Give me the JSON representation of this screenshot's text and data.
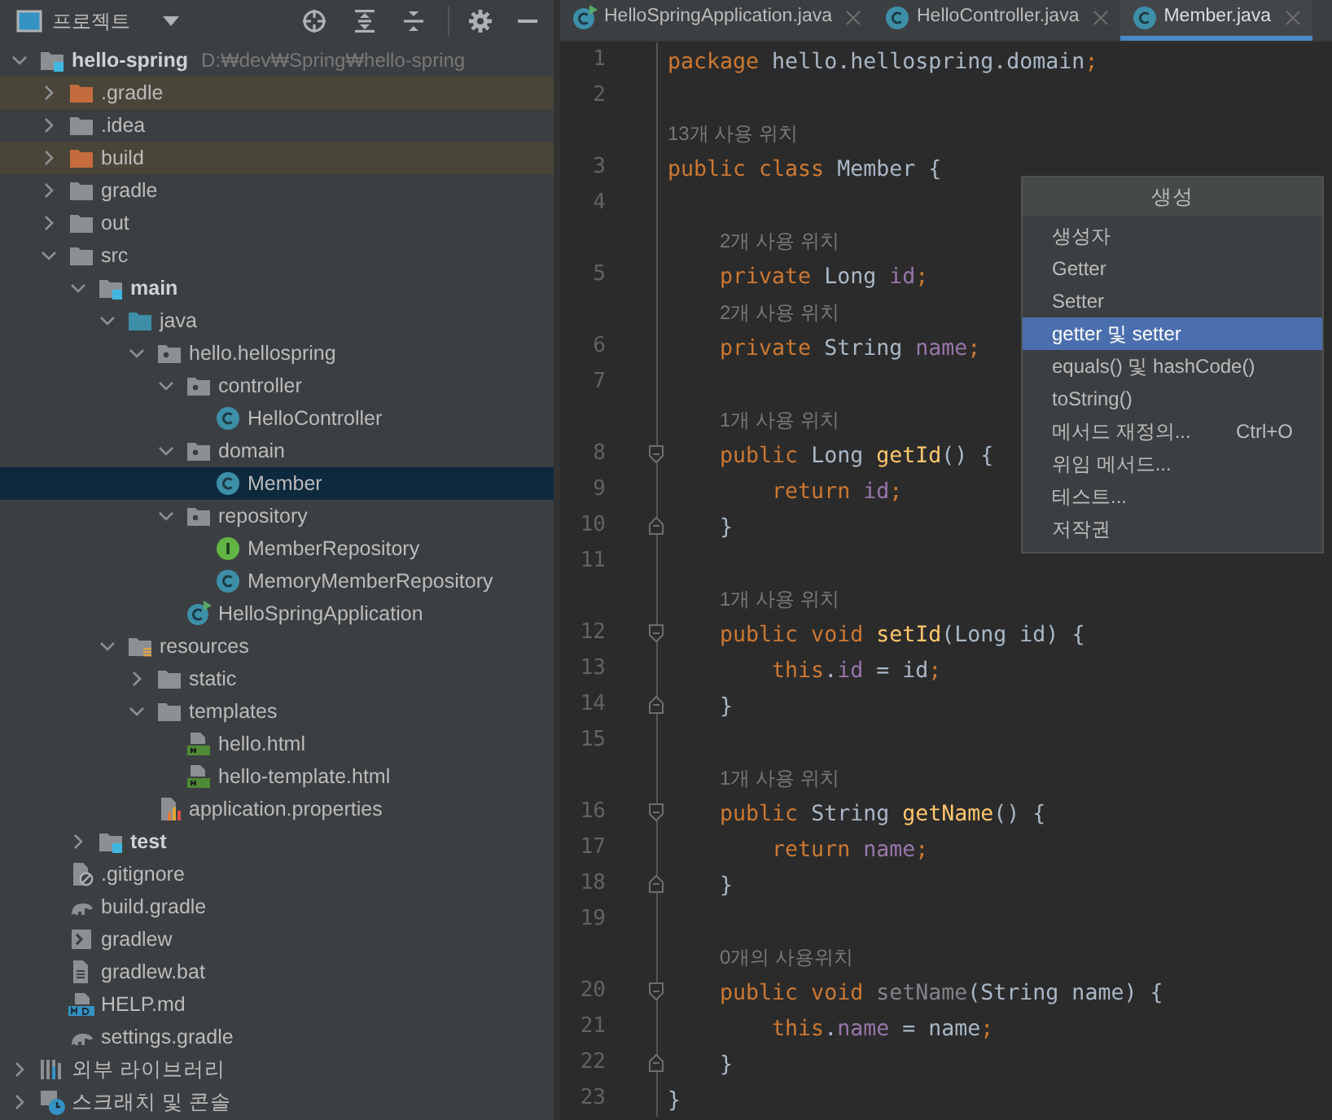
{
  "project_panel": {
    "title": "프로젝트",
    "tree": [
      {
        "label": "hello-spring",
        "path": "D:₩dev₩Spring₩hello-spring",
        "kind": "module",
        "expanded": true,
        "selected": false,
        "children": [
          {
            "label": ".gradle",
            "kind": "excluded",
            "expanded": false,
            "selected": false
          },
          {
            "label": ".idea",
            "kind": "folder",
            "expanded": false,
            "selected": false
          },
          {
            "label": "build",
            "kind": "excluded",
            "expanded": false,
            "selected": false
          },
          {
            "label": "gradle",
            "kind": "folder",
            "expanded": false,
            "selected": false
          },
          {
            "label": "out",
            "kind": "folder",
            "expanded": false,
            "selected": false
          },
          {
            "label": "src",
            "kind": "folder",
            "expanded": true,
            "selected": false,
            "children": [
              {
                "label": "main",
                "kind": "module",
                "expanded": true,
                "selected": false,
                "children": [
                  {
                    "label": "java",
                    "kind": "source",
                    "expanded": true,
                    "selected": false,
                    "children": [
                      {
                        "label": "hello.hellospring",
                        "kind": "package",
                        "expanded": true,
                        "selected": false,
                        "children": [
                          {
                            "label": "controller",
                            "kind": "package",
                            "expanded": true,
                            "selected": false,
                            "children": [
                              {
                                "label": "HelloController",
                                "kind": "class",
                                "selected": false
                              }
                            ]
                          },
                          {
                            "label": "domain",
                            "kind": "package",
                            "expanded": true,
                            "selected": false,
                            "children": [
                              {
                                "label": "Member",
                                "kind": "class",
                                "selected": true
                              }
                            ]
                          },
                          {
                            "label": "repository",
                            "kind": "package",
                            "expanded": true,
                            "selected": false,
                            "children": [
                              {
                                "label": "MemberRepository",
                                "kind": "interface",
                                "selected": false
                              },
                              {
                                "label": "MemoryMemberRepository",
                                "kind": "class",
                                "selected": false
                              }
                            ]
                          },
                          {
                            "label": "HelloSpringApplication",
                            "kind": "app",
                            "selected": false
                          }
                        ]
                      }
                    ]
                  },
                  {
                    "label": "resources",
                    "kind": "resources",
                    "expanded": true,
                    "selected": false,
                    "children": [
                      {
                        "label": "static",
                        "kind": "folder",
                        "expanded": false,
                        "selected": false
                      },
                      {
                        "label": "templates",
                        "kind": "folder",
                        "expanded": true,
                        "selected": false,
                        "children": [
                          {
                            "label": "hello.html",
                            "kind": "html",
                            "selected": false
                          },
                          {
                            "label": "hello-template.html",
                            "kind": "html",
                            "selected": false
                          }
                        ]
                      },
                      {
                        "label": "application.properties",
                        "kind": "properties",
                        "selected": false
                      }
                    ]
                  }
                ]
              },
              {
                "label": "test",
                "kind": "module",
                "expanded": false,
                "selected": false
              }
            ]
          },
          {
            "label": ".gitignore",
            "kind": "ignore",
            "selected": false
          },
          {
            "label": "build.gradle",
            "kind": "gradle",
            "selected": false
          },
          {
            "label": "gradlew",
            "kind": "shell",
            "selected": false
          },
          {
            "label": "gradlew.bat",
            "kind": "text",
            "selected": false
          },
          {
            "label": "HELP.md",
            "kind": "md",
            "selected": false
          },
          {
            "label": "settings.gradle",
            "kind": "gradle",
            "selected": false
          }
        ]
      },
      {
        "label": "외부 라이브러리",
        "kind": "libraries",
        "expanded": false,
        "selected": false
      },
      {
        "label": "스크래치 및 콘솔",
        "kind": "scratches",
        "expanded": false,
        "selected": false
      }
    ]
  },
  "tabs": [
    {
      "label": "HelloSpringApplication.java",
      "kind": "app",
      "selected": false
    },
    {
      "label": "HelloController.java",
      "kind": "class",
      "selected": false
    },
    {
      "label": "Member.java",
      "kind": "class",
      "selected": true
    }
  ],
  "editor": {
    "rows": [
      {
        "kind": "code",
        "number": "1",
        "tokens": [
          {
            "text": "package",
            "kind": "keyword"
          },
          {
            "text": " hello.hellospring.domain",
            "kind": "plain"
          },
          {
            "text": ";",
            "kind": "keyword"
          }
        ]
      },
      {
        "kind": "code",
        "number": "2",
        "tokens": []
      },
      {
        "kind": "hint",
        "text": "13개 사용 위치"
      },
      {
        "kind": "code",
        "number": "3",
        "tokens": [
          {
            "text": "public class",
            "kind": "keyword"
          },
          {
            "text": " Member {",
            "kind": "plain"
          }
        ]
      },
      {
        "kind": "code",
        "number": "4",
        "tokens": []
      },
      {
        "kind": "hint",
        "text": "    2개 사용 위치"
      },
      {
        "kind": "code",
        "number": "5",
        "tokens": [
          {
            "text": "    private",
            "kind": "keyword"
          },
          {
            "text": " Long",
            "kind": "plain"
          },
          {
            "text": " id",
            "kind": "field"
          },
          {
            "text": ";",
            "kind": "keyword"
          }
        ]
      },
      {
        "kind": "hint",
        "text": "    2개 사용 위치"
      },
      {
        "kind": "code",
        "number": "6",
        "tokens": [
          {
            "text": "    private",
            "kind": "keyword"
          },
          {
            "text": " String",
            "kind": "plain"
          },
          {
            "text": " name",
            "kind": "field"
          },
          {
            "text": ";",
            "kind": "keyword"
          }
        ]
      },
      {
        "kind": "code",
        "number": "7",
        "tokens": []
      },
      {
        "kind": "hint",
        "text": "    1개 사용 위치"
      },
      {
        "kind": "code",
        "number": "8",
        "fold_start": true,
        "tokens": [
          {
            "text": "    public",
            "kind": "keyword"
          },
          {
            "text": " Long",
            "kind": "plain"
          },
          {
            "text": " getId",
            "kind": "method"
          },
          {
            "text": "() {",
            "kind": "plain"
          }
        ]
      },
      {
        "kind": "code",
        "number": "9",
        "tokens": [
          {
            "text": "        return",
            "kind": "keyword"
          },
          {
            "text": " id",
            "kind": "field"
          },
          {
            "text": ";",
            "kind": "keyword"
          }
        ]
      },
      {
        "kind": "code",
        "number": "10",
        "fold_end": true,
        "tokens": [
          {
            "text": "    }",
            "kind": "plain"
          }
        ]
      },
      {
        "kind": "code",
        "number": "11",
        "tokens": []
      },
      {
        "kind": "hint",
        "text": "    1개 사용 위치"
      },
      {
        "kind": "code",
        "number": "12",
        "fold_start": true,
        "tokens": [
          {
            "text": "    public void",
            "kind": "keyword"
          },
          {
            "text": " setId",
            "kind": "method"
          },
          {
            "text": "(Long id) {",
            "kind": "plain"
          }
        ]
      },
      {
        "kind": "code",
        "number": "13",
        "tokens": [
          {
            "text": "        this",
            "kind": "keyword"
          },
          {
            "text": ".",
            "kind": "plain"
          },
          {
            "text": "id",
            "kind": "field"
          },
          {
            "text": " = id",
            "kind": "plain"
          },
          {
            "text": ";",
            "kind": "keyword"
          }
        ]
      },
      {
        "kind": "code",
        "number": "14",
        "fold_end": true,
        "tokens": [
          {
            "text": "    }",
            "kind": "plain"
          }
        ]
      },
      {
        "kind": "code",
        "number": "15",
        "tokens": []
      },
      {
        "kind": "hint",
        "text": "    1개 사용 위치"
      },
      {
        "kind": "code",
        "number": "16",
        "fold_start": true,
        "tokens": [
          {
            "text": "    public",
            "kind": "keyword"
          },
          {
            "text": " String",
            "kind": "plain"
          },
          {
            "text": " getName",
            "kind": "method"
          },
          {
            "text": "() {",
            "kind": "plain"
          }
        ]
      },
      {
        "kind": "code",
        "number": "17",
        "tokens": [
          {
            "text": "        return",
            "kind": "keyword"
          },
          {
            "text": " name",
            "kind": "field"
          },
          {
            "text": ";",
            "kind": "keyword"
          }
        ]
      },
      {
        "kind": "code",
        "number": "18",
        "fold_end": true,
        "tokens": [
          {
            "text": "    }",
            "kind": "plain"
          }
        ]
      },
      {
        "kind": "code",
        "number": "19",
        "tokens": []
      },
      {
        "kind": "hint",
        "text": "    0개의 사용위치"
      },
      {
        "kind": "code",
        "number": "20",
        "fold_start": true,
        "tokens": [
          {
            "text": "    public void",
            "kind": "keyword"
          },
          {
            "text": " setName",
            "kind": "unused"
          },
          {
            "text": "(String name) {",
            "kind": "plain"
          }
        ]
      },
      {
        "kind": "code",
        "number": "21",
        "tokens": [
          {
            "text": "        this",
            "kind": "keyword"
          },
          {
            "text": ".",
            "kind": "plain"
          },
          {
            "text": "name",
            "kind": "field"
          },
          {
            "text": " = name",
            "kind": "plain"
          },
          {
            "text": ";",
            "kind": "keyword"
          }
        ]
      },
      {
        "kind": "code",
        "number": "22",
        "fold_end": true,
        "tokens": [
          {
            "text": "    }",
            "kind": "plain"
          }
        ]
      },
      {
        "kind": "code",
        "number": "23",
        "tokens": [
          {
            "text": "}",
            "kind": "plain"
          }
        ]
      }
    ]
  },
  "generate_menu": {
    "title": "생성",
    "items": [
      {
        "label": "생성자",
        "selected": false
      },
      {
        "label": "Getter",
        "selected": false
      },
      {
        "label": "Setter",
        "selected": false
      },
      {
        "label": "getter 및 setter",
        "selected": true
      },
      {
        "label": "equals() 및 hashCode()",
        "selected": false
      },
      {
        "label": "toString()",
        "selected": false
      },
      {
        "label": "메서드 재정의...",
        "shortcut": "Ctrl+O",
        "selected": false
      },
      {
        "label": "위임 메서드...",
        "selected": false
      },
      {
        "label": "테스트...",
        "selected": false
      },
      {
        "label": "저작권",
        "selected": false
      }
    ]
  }
}
